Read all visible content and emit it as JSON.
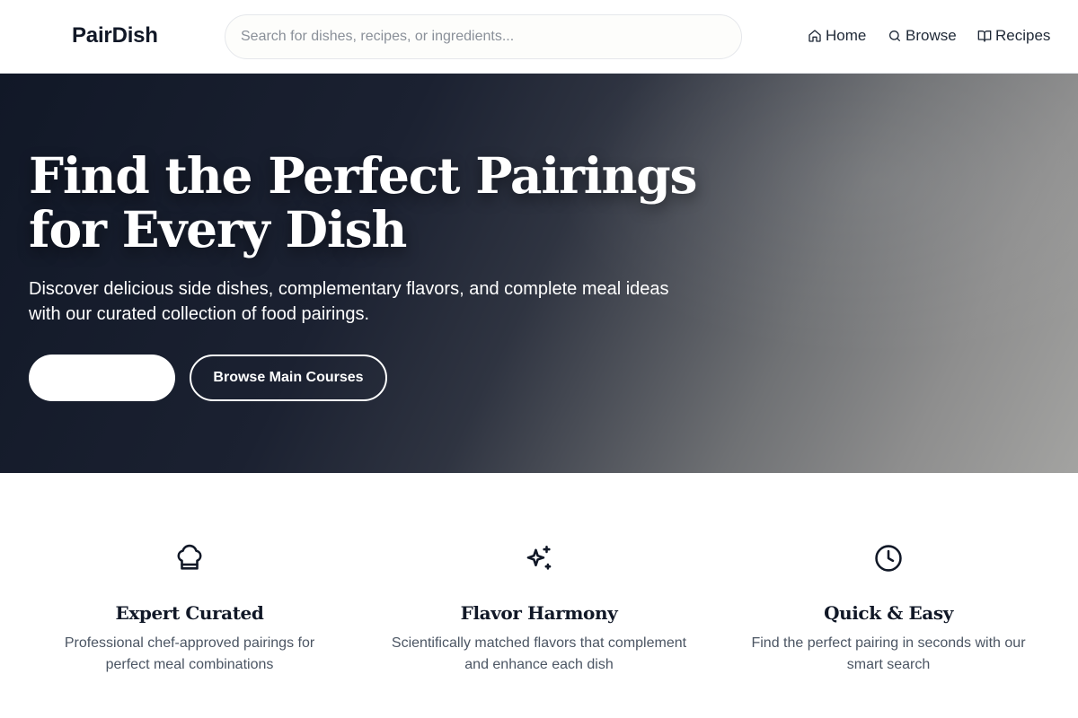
{
  "app": {
    "name": "PairDish"
  },
  "header": {
    "search_placeholder": "Search for dishes, recipes, or ingredients...",
    "nav": [
      {
        "label": "Home",
        "icon": "home-icon"
      },
      {
        "label": "Browse",
        "icon": "search-icon"
      },
      {
        "label": "Recipes",
        "icon": "book-icon"
      }
    ]
  },
  "hero": {
    "title_line1": "Find the Perfect Pairings",
    "title_line2": "for Every Dish",
    "subtitle_line1": "Discover delicious side dishes, complementary flavors, and complete meal ideas",
    "subtitle_line2": "with our curated collection of food pairings.",
    "primary_button_label": "",
    "secondary_button_label": "Browse Main Courses"
  },
  "features": [
    {
      "icon": "chef-hat-icon",
      "title": "Expert Curated",
      "desc_line1": "Professional chef-approved pairings for",
      "desc_line2": "perfect meal combinations"
    },
    {
      "icon": "sparkles-icon",
      "title": "Flavor Harmony",
      "desc_line1": "Scientifically matched flavors that complement",
      "desc_line2": "and enhance each dish"
    },
    {
      "icon": "clock-icon",
      "title": "Quick & Easy",
      "desc_line1": "Find the perfect pairing in seconds with our",
      "desc_line2": "smart search"
    }
  ],
  "colors": {
    "text_dark": "#111827",
    "text_muted": "#4b5563",
    "hero_dark": "#111827",
    "hero_light": "#a3a3a1",
    "background": "#ffffff"
  }
}
